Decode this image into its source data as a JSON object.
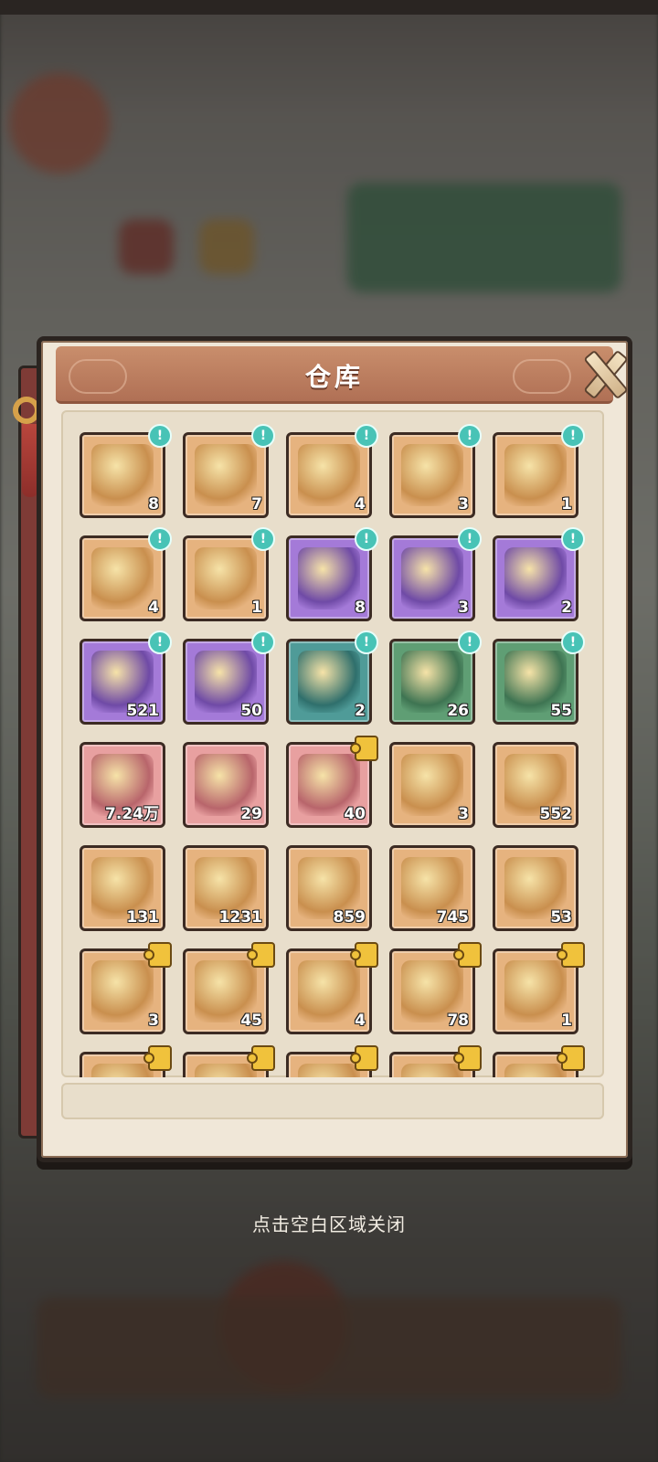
{
  "panel": {
    "title": "仓库",
    "close_icon": "close-x-icon"
  },
  "colors": {
    "orange": "#e6b37f",
    "purple": "#a47ad8",
    "teal": "#4f9b98",
    "green": "#5f9e74",
    "pink": "#e8a0a0"
  },
  "items": [
    {
      "icon": "golden-treasure-chest-icon",
      "count": "8",
      "bg": "orange",
      "badge": "!"
    },
    {
      "icon": "puzzle-fragment-chest-icon",
      "count": "7",
      "bg": "orange",
      "badge": "!"
    },
    {
      "icon": "mystery-chest-icon",
      "count": "4",
      "bg": "orange",
      "badge": "!"
    },
    {
      "icon": "mystery-chest-icon",
      "count": "3",
      "bg": "orange",
      "badge": "!"
    },
    {
      "icon": "golden-egg-chest-icon",
      "count": "1",
      "bg": "orange",
      "badge": "!"
    },
    {
      "icon": "mystery-open-chest-icon",
      "count": "4",
      "bg": "orange",
      "badge": "!"
    },
    {
      "icon": "mystery-gem-chest-icon",
      "count": "1",
      "bg": "orange",
      "badge": "!"
    },
    {
      "icon": "purple-treasure-chest-icon",
      "count": "8",
      "bg": "purple",
      "badge": "!"
    },
    {
      "icon": "purple-puzzle-chest-icon",
      "count": "3",
      "bg": "purple",
      "badge": "!"
    },
    {
      "icon": "purple-mystery-chest-icon",
      "count": "2",
      "bg": "purple",
      "badge": "!"
    },
    {
      "icon": "gem-chest-icon",
      "count": "521",
      "bg": "purple",
      "badge": "!"
    },
    {
      "icon": "flame-chest-icon",
      "count": "50",
      "bg": "purple",
      "badge": "!"
    },
    {
      "icon": "teal-mystery-chest-icon",
      "count": "2",
      "bg": "teal",
      "badge": "!"
    },
    {
      "icon": "green-mystery-chest-icon",
      "count": "26",
      "bg": "green",
      "badge": "!"
    },
    {
      "icon": "green-mystery-gem-chest-icon",
      "count": "55",
      "bg": "green",
      "badge": "!"
    },
    {
      "icon": "scroll-icon",
      "count": "7.24万",
      "bg": "pink",
      "badge": ""
    },
    {
      "icon": "green-orb-icon",
      "count": "29",
      "bg": "pink",
      "badge": ""
    },
    {
      "icon": "green-gourd-icon",
      "count": "40",
      "bg": "pink",
      "badge": "puzzle"
    },
    {
      "icon": "potion-icon",
      "count": "3",
      "bg": "orange",
      "badge": ""
    },
    {
      "icon": "golden-key-icon",
      "count": "552",
      "bg": "orange",
      "badge": ""
    },
    {
      "icon": "spoon-tablet-icon",
      "count": "131",
      "bg": "orange",
      "badge": ""
    },
    {
      "icon": "talisman-paper-icon",
      "count": "1231",
      "bg": "orange",
      "badge": ""
    },
    {
      "icon": "bronze-key-icon",
      "count": "859",
      "bg": "orange",
      "badge": ""
    },
    {
      "icon": "ticket-icon",
      "count": "745",
      "bg": "orange",
      "badge": ""
    },
    {
      "icon": "rainbow-stone-icon",
      "count": "53",
      "bg": "orange",
      "badge": ""
    },
    {
      "icon": "pagoda-icon",
      "count": "3",
      "bg": "orange",
      "badge": "puzzle"
    },
    {
      "icon": "golden-axe-icon",
      "count": "45",
      "bg": "orange",
      "badge": "puzzle"
    },
    {
      "icon": "jade-blade-icon",
      "count": "4",
      "bg": "orange",
      "badge": "puzzle"
    },
    {
      "icon": "blue-mirror-icon",
      "count": "78",
      "bg": "orange",
      "badge": "puzzle"
    },
    {
      "icon": "bronze-cauldron-icon",
      "count": "1",
      "bg": "orange",
      "badge": "puzzle"
    },
    {
      "icon": "spear-icon",
      "count": "",
      "bg": "orange",
      "badge": "puzzle"
    },
    {
      "icon": "staff-icon",
      "count": "",
      "bg": "orange",
      "badge": "puzzle"
    },
    {
      "icon": "bow-icon",
      "count": "",
      "bg": "orange",
      "badge": "puzzle"
    },
    {
      "icon": "dragon-icon",
      "count": "",
      "bg": "orange",
      "badge": "puzzle"
    },
    {
      "icon": "dragon-icon",
      "count": "",
      "bg": "orange",
      "badge": "puzzle"
    }
  ],
  "hint": "点击空白区域关闭"
}
